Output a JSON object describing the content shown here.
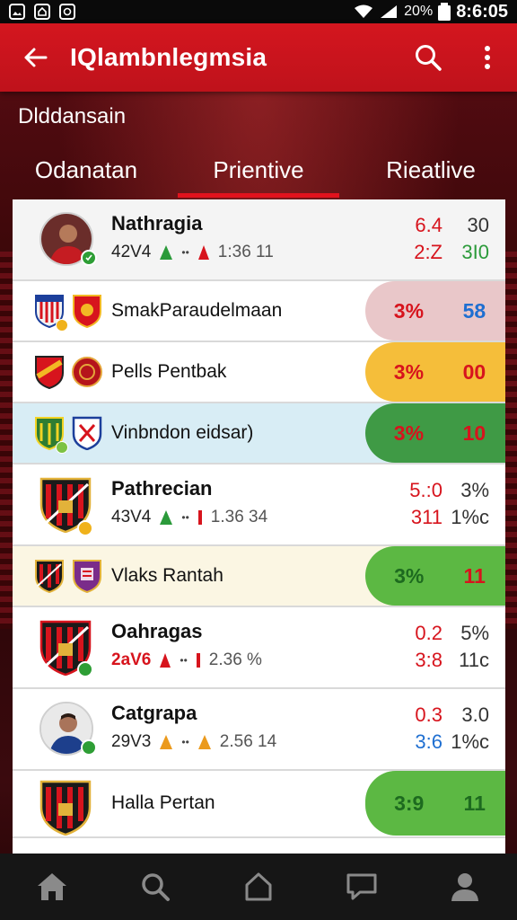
{
  "status_bar": {
    "battery_percent": "20%",
    "time": "8:6:05",
    "icons": [
      "image-icon",
      "home-outline-icon",
      "record-icon",
      "wifi-icon",
      "signal-icon",
      "battery-icon"
    ]
  },
  "app_bar": {
    "title": "IQlambnlegmsia",
    "back_icon": "arrow-left-icon",
    "actions": [
      "search-icon",
      "more-vert-icon"
    ],
    "color": "#d4161f"
  },
  "section_title": "Dlddansain",
  "tabs": [
    {
      "label": "Odanatan",
      "active": false
    },
    {
      "label": "Prientive",
      "active": true
    },
    {
      "label": "Rieatlive",
      "active": false
    }
  ],
  "rows": [
    {
      "kind": "player",
      "name": "Nathragia",
      "code": "42V4",
      "dot": "••",
      "time": "1:36 11",
      "top_a": "6.4",
      "top_b": "30",
      "bot_a": "2:Z",
      "bot_b": "3I0",
      "colors": {
        "top_a": "#d7141d",
        "top_b": "#333",
        "bot_a": "#d7141d",
        "bot_b": "#2b9a3a"
      }
    },
    {
      "kind": "match",
      "name": "SmakParaudelmaan",
      "left": "3%",
      "right": "58",
      "pill": "#e9c7c9",
      "colors": {
        "left": "#d7141d",
        "right": "#1f6fd1"
      },
      "row_bg": "#ffffff"
    },
    {
      "kind": "match",
      "name": "Pells Pentbak",
      "left": "3%",
      "right": "00",
      "pill": "#f5be3a",
      "colors": {
        "left": "#d7141d",
        "right": "#d7141d"
      },
      "row_bg": "#ffffff"
    },
    {
      "kind": "match",
      "name": "Vinbndon eidsar)",
      "left": "3%",
      "right": "10",
      "pill": "#3f9a45",
      "colors": {
        "left": "#d7141d",
        "right": "#d7141d"
      },
      "row_bg": "#d8edf5"
    },
    {
      "kind": "club",
      "name": "Pathrecian",
      "code": "43V4",
      "dot": "••",
      "time": "1.36 34",
      "top_a": "5.:0",
      "top_b": "3%",
      "bot_a": "311",
      "bot_b": "1%c",
      "colors": {
        "top_a": "#d7141d",
        "top_b": "#333",
        "bot_a": "#d7141d",
        "bot_b": "#333"
      }
    },
    {
      "kind": "match",
      "name": "Vlaks Rantah",
      "left": "3%",
      "right": "11",
      "pill": "#5cb843",
      "colors": {
        "left": "#1d6a1f",
        "right": "#d7141d"
      },
      "row_bg": "#fbf6e3"
    },
    {
      "kind": "club",
      "name": "Oahragas",
      "code": "2aV6",
      "dot": "••",
      "time": "2.36 %",
      "top_a": "0.2",
      "top_b": "5%",
      "bot_a": "3:8",
      "bot_b": "11c",
      "colors": {
        "top_a": "#d7141d",
        "top_b": "#333",
        "bot_a": "#d7141d",
        "bot_b": "#333"
      }
    },
    {
      "kind": "player2",
      "name": "Catgrapa",
      "code": "29V3",
      "dot": "••",
      "time": "2.56 14",
      "top_a": "0.3",
      "top_b": "3.0",
      "bot_a": "3:6",
      "bot_b": "1%c",
      "colors": {
        "top_a": "#d7141d",
        "top_b": "#333",
        "bot_a": "#1f6fd1",
        "bot_b": "#333"
      }
    },
    {
      "kind": "club-match",
      "name": "Halla Pertan",
      "left": "3:9",
      "right": "11",
      "pill": "#5cb843",
      "colors": {
        "left": "#1d6a1f",
        "right": "#1d6a1f"
      },
      "row_bg": "#ffffff"
    }
  ],
  "bottom_nav": [
    "home-icon",
    "search-icon",
    "house-outline-icon",
    "chat-icon",
    "profile-icon"
  ]
}
